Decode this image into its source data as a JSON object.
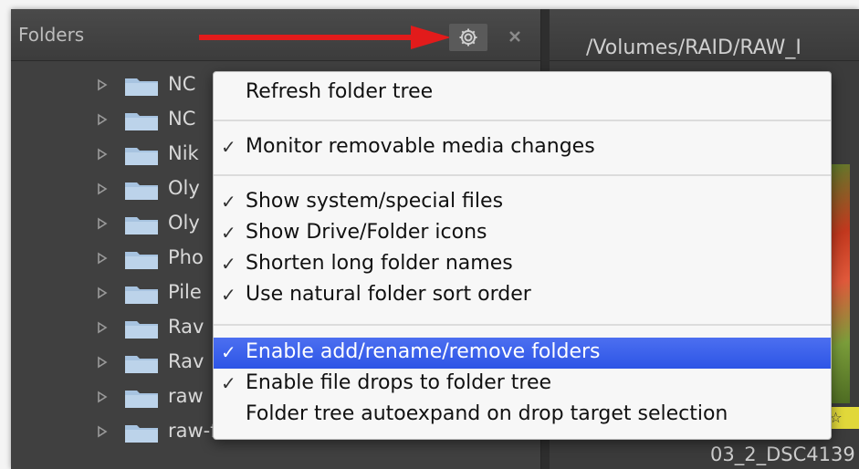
{
  "folders_panel": {
    "title": "Folders",
    "tree_items": [
      {
        "label": "NC"
      },
      {
        "label": "NC"
      },
      {
        "label": "Nik"
      },
      {
        "label": "Oly"
      },
      {
        "label": "Oly"
      },
      {
        "label": "Pho"
      },
      {
        "label": "Pile"
      },
      {
        "label": "Rav"
      },
      {
        "label": "Rav"
      },
      {
        "label": "raw"
      },
      {
        "label": "raw-from-various-cameras"
      }
    ],
    "icons": {
      "gear": "gear-icon",
      "close": "close-icon",
      "expander": "triangle-right-icon",
      "folder": "folder-icon"
    },
    "colors": {
      "folder_icon": "#a7c3e0",
      "annotation_arrow": "#e21b1b"
    }
  },
  "right_panel": {
    "path": "/Volumes/RAID/RAW_I",
    "thumbnail_label": "03_2_DSC4139",
    "stars": "☆☆"
  },
  "context_menu": {
    "items": [
      {
        "label": "Refresh folder tree",
        "checked": false,
        "highlighted": false
      },
      {
        "label": "Monitor removable media changes",
        "checked": true,
        "highlighted": false
      },
      {
        "label": "Show system/special files",
        "checked": true,
        "highlighted": false
      },
      {
        "label": "Show Drive/Folder icons",
        "checked": true,
        "highlighted": false
      },
      {
        "label": "Shorten long folder names",
        "checked": true,
        "highlighted": false
      },
      {
        "label": "Use natural folder sort order",
        "checked": true,
        "highlighted": false
      },
      {
        "label": "Enable add/rename/remove folders",
        "checked": true,
        "highlighted": true
      },
      {
        "label": "Enable file drops to folder tree",
        "checked": true,
        "highlighted": false
      },
      {
        "label": "Folder tree autoexpand on drop target selection",
        "checked": false,
        "highlighted": false
      }
    ],
    "check_glyph": "✓",
    "colors": {
      "highlight": "#3a5fe8"
    }
  }
}
